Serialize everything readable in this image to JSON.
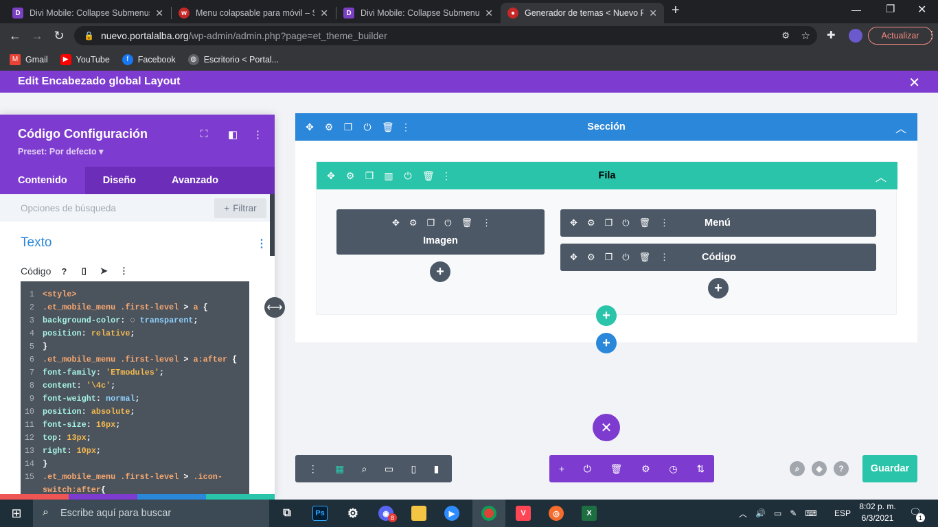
{
  "browser": {
    "tabs": [
      {
        "title": "Divi Mobile: Collapse Submenus",
        "icon": "divi-icon",
        "color": "#7b3fc4",
        "active": false
      },
      {
        "title": "Menu colapsable para móvil – Sc",
        "icon": "w-icon",
        "color": "#c62828",
        "active": false
      },
      {
        "title": "Divi Mobile: Collapse Submenus",
        "icon": "divi-icon",
        "color": "#7b3fc4",
        "active": false
      },
      {
        "title": "Generador de temas < Nuevo Po",
        "icon": "portal-icon",
        "color": "#c62828",
        "active": true
      }
    ],
    "new_tab": "+",
    "url_host": "nuevo.portalalba.org",
    "url_path": "/wp-admin/admin.php?page=et_theme_builder",
    "update_label": "Actualizar",
    "bookmarks": [
      {
        "label": "Gmail",
        "icon": "gmail-icon",
        "color": "#ea4335"
      },
      {
        "label": "YouTube",
        "icon": "youtube-icon",
        "color": "#ff0000"
      },
      {
        "label": "Facebook",
        "icon": "facebook-icon",
        "color": "#1877f2"
      },
      {
        "label": "Escritorio < Portal...",
        "icon": "globe-icon",
        "color": "#5f6368"
      }
    ]
  },
  "header": {
    "title": "Edit Encabezado global Layout"
  },
  "panel": {
    "title": "Código Configuración",
    "preset": "Preset: Por defecto ▾",
    "tabs": [
      "Contenido",
      "Diseño",
      "Avanzado"
    ],
    "search_placeholder": "Opciones de búsqueda",
    "filter_label": "Filtrar",
    "section_title": "Texto",
    "code_label": "Código",
    "code_lines": [
      {
        "n": "1",
        "parts": [
          [
            "sel",
            "<style>"
          ]
        ]
      },
      {
        "n": "2",
        "parts": [
          [
            "sel",
            ".et_mobile_menu .first-level"
          ],
          [
            "",
            " > "
          ],
          [
            "sel",
            "a"
          ],
          [
            "",
            " {"
          ]
        ]
      },
      {
        "n": "3",
        "parts": [
          [
            "pr",
            "background-color"
          ],
          [
            "",
            ": ◌ "
          ],
          [
            "vb",
            "transparent"
          ],
          [
            "",
            ";"
          ]
        ]
      },
      {
        "n": "4",
        "parts": [
          [
            "pr",
            "position"
          ],
          [
            "",
            ": "
          ],
          [
            "vl",
            "relative"
          ],
          [
            "",
            ";"
          ]
        ]
      },
      {
        "n": "5",
        "parts": [
          [
            "",
            "}"
          ]
        ]
      },
      {
        "n": "6",
        "parts": [
          [
            "sel",
            ".et_mobile_menu .first-level"
          ],
          [
            "",
            " > "
          ],
          [
            "sel",
            "a:after"
          ],
          [
            "",
            " {"
          ]
        ]
      },
      {
        "n": "7",
        "parts": [
          [
            "pr",
            "font-family"
          ],
          [
            "",
            ": "
          ],
          [
            "vl",
            "'ETmodules'"
          ],
          [
            "",
            ";"
          ]
        ]
      },
      {
        "n": "8",
        "parts": [
          [
            "pr",
            "content"
          ],
          [
            "",
            ": "
          ],
          [
            "vl",
            "'\\4c'"
          ],
          [
            "",
            ";"
          ]
        ]
      },
      {
        "n": "9",
        "parts": [
          [
            "pr",
            "font-weight"
          ],
          [
            "",
            ": "
          ],
          [
            "vb",
            "normal"
          ],
          [
            "",
            ";"
          ]
        ]
      },
      {
        "n": "10",
        "parts": [
          [
            "pr",
            "position"
          ],
          [
            "",
            ": "
          ],
          [
            "vl",
            "absolute"
          ],
          [
            "",
            ";"
          ]
        ]
      },
      {
        "n": "11",
        "parts": [
          [
            "pr",
            "font-size"
          ],
          [
            "",
            ": "
          ],
          [
            "vl",
            "16px"
          ],
          [
            "",
            ";"
          ]
        ]
      },
      {
        "n": "12",
        "parts": [
          [
            "pr",
            "top"
          ],
          [
            "",
            ": "
          ],
          [
            "vl",
            "13px"
          ],
          [
            "",
            ";"
          ]
        ]
      },
      {
        "n": "13",
        "parts": [
          [
            "pr",
            "right"
          ],
          [
            "",
            ": "
          ],
          [
            "vl",
            "10px"
          ],
          [
            "",
            ";"
          ]
        ]
      },
      {
        "n": "14",
        "parts": [
          [
            "",
            "}"
          ]
        ]
      },
      {
        "n": "15",
        "parts": [
          [
            "sel",
            ".et_mobile_menu .first-level"
          ],
          [
            "",
            " > "
          ],
          [
            "sel",
            ".icon-"
          ]
        ]
      },
      {
        "n": "",
        "parts": [
          [
            "sel",
            "switch:after"
          ],
          [
            "",
            "{"
          ]
        ]
      }
    ],
    "footer_colors": [
      "#ef5555",
      "#7e3bd0",
      "#2b87da",
      "#29c4a9"
    ]
  },
  "builder": {
    "section_label": "Sección",
    "row_label": "Fila",
    "modules": [
      "Imagen",
      "Menú",
      "Código"
    ],
    "save_label": "Guardar",
    "colors": {
      "section": "#2b87da",
      "row": "#29c4a9",
      "module": "#4c5866",
      "purple": "#7e3bd0"
    }
  },
  "taskbar": {
    "search_placeholder": "Escribe aquí para buscar",
    "lang": "ESP",
    "time": "8:02 p. m.",
    "date": "6/3/2021",
    "notifications": "1",
    "badge": "8"
  }
}
